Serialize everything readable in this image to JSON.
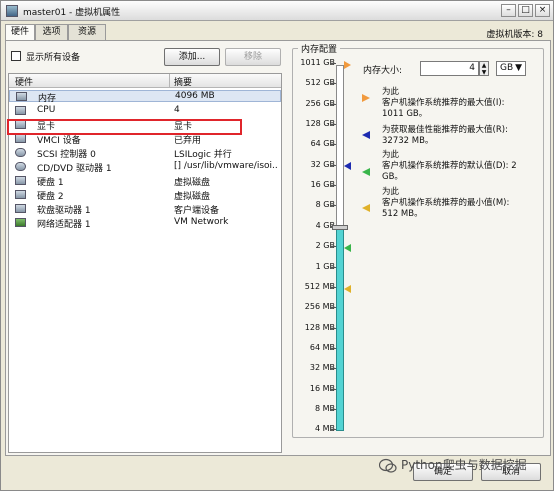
{
  "window": {
    "title": "master01 - 虚拟机属性",
    "version": "虚拟机版本: 8"
  },
  "title_buttons": [
    "–",
    "□",
    "×"
  ],
  "tabs": [
    {
      "label": "硬件"
    },
    {
      "label": "选项"
    },
    {
      "label": "资源"
    }
  ],
  "hardware": {
    "show_all_label": "显示所有设备",
    "add_button": "添加...",
    "remove_button": "移除",
    "col_hardware": "硬件",
    "col_summary": "摘要",
    "rows": [
      {
        "name": "内存",
        "summary": "4096 MB"
      },
      {
        "name": "CPU",
        "summary": "4"
      },
      {
        "name": "显卡",
        "summary": "显卡"
      },
      {
        "name": "VMCI 设备",
        "summary": "已弃用"
      },
      {
        "name": "SCSI 控制器  0",
        "summary": "LSILogic 并行"
      },
      {
        "name": "CD/DVD 驱动器  1",
        "summary": "[] /usr/lib/vmware/isoi..."
      },
      {
        "name": "硬盘  1",
        "summary": "虚拟磁盘"
      },
      {
        "name": "硬盘  2",
        "summary": "虚拟磁盘"
      },
      {
        "name": "软盘驱动器  1",
        "summary": "客户端设备"
      },
      {
        "name": "网络适配器  1",
        "summary": "VM Network"
      }
    ]
  },
  "memory": {
    "group_title": "内存配置",
    "size_label": "内存大小:",
    "size_value": "4",
    "unit": "GB",
    "scale": [
      "1011 GB",
      "512 GB",
      "256 GB",
      "128 GB",
      "64 GB",
      "32 GB",
      "16 GB",
      "8 GB",
      "4 GB",
      "2 GB",
      "1 GB",
      "512 MB",
      "256 MB",
      "128 MB",
      "64 MB",
      "32 MB",
      "16 MB",
      "8 MB",
      "4 MB"
    ],
    "legend": [
      {
        "line1": "为此",
        "line2": "客户机操作系统推荐的最大值(I):",
        "line3": "1011 GB。",
        "color": "#f19a3e"
      },
      {
        "line1": "为获取最佳性能推荐的最大值(R):",
        "line2": "32732 MB。",
        "line3": "",
        "color": "#1d2bb0"
      },
      {
        "line1": "为此",
        "line2": "客户机操作系统推荐的默认值(D): 2",
        "line3": "GB。",
        "color": "#39b54a"
      },
      {
        "line1": "为此",
        "line2": "客户机操作系统推荐的最小值(M):",
        "line3": "512 MB。",
        "color": "#e0b12a"
      }
    ]
  },
  "footer": {
    "ok": "确定",
    "cancel": "取消"
  },
  "watermark": "Python爬虫与数据挖掘"
}
